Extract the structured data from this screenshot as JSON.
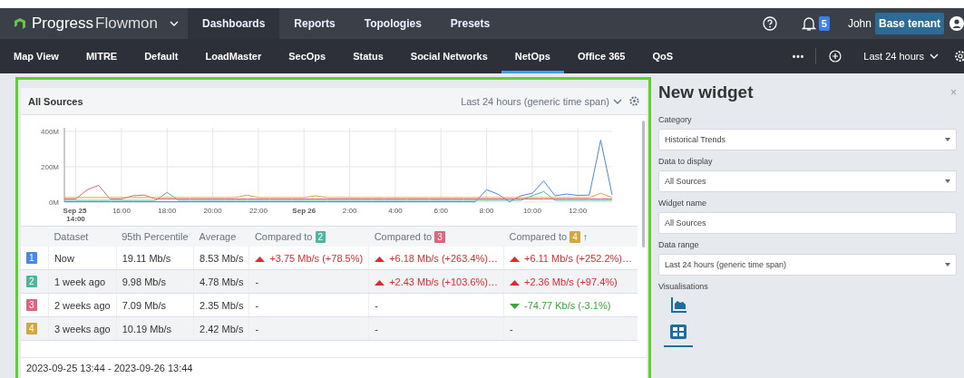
{
  "topbar": {
    "logo": {
      "brand": "Progress",
      "product": "Flowmon"
    },
    "menu": [
      {
        "label": "Dashboards",
        "selected": true
      },
      {
        "label": "Reports",
        "selected": false
      },
      {
        "label": "Topologies",
        "selected": false
      },
      {
        "label": "Presets",
        "selected": false
      }
    ],
    "notifications": "5",
    "user": "John",
    "tenant": "Base tenant"
  },
  "dashboard_tabs": [
    {
      "label": "Map View",
      "selected": false
    },
    {
      "label": "MITRE",
      "selected": false
    },
    {
      "label": "Default",
      "selected": false
    },
    {
      "label": "LoadMaster",
      "selected": false
    },
    {
      "label": "SecOps",
      "selected": false
    },
    {
      "label": "Status",
      "selected": false
    },
    {
      "label": "Social Networks",
      "selected": false
    },
    {
      "label": "NetOps",
      "selected": true
    },
    {
      "label": "Office 365",
      "selected": false
    },
    {
      "label": "QoS",
      "selected": false
    }
  ],
  "more": "•••",
  "time_range": "Last 24 hours",
  "widget": {
    "title": "All Sources",
    "time_span": "Last 24 hours (generic time span)",
    "chart_data": {
      "type": "line",
      "categories": [
        null,
        "Sep 25 14:00",
        null,
        null,
        null,
        "16:00",
        null,
        null,
        null,
        "18:00",
        null,
        null,
        null,
        "20:00",
        null,
        null,
        null,
        "22:00",
        null,
        null,
        null,
        "Sep 26",
        null,
        null,
        null,
        "2:00",
        null,
        null,
        null,
        "4:00",
        null,
        null,
        null,
        "6:00",
        null,
        null,
        null,
        "8:00",
        null,
        null,
        null,
        "10:00",
        null,
        null,
        null,
        "12:00",
        null,
        null,
        null
      ],
      "yticks": [
        {
          "value": 0,
          "label": "0M"
        },
        {
          "value": 200,
          "label": "200M"
        },
        {
          "value": 400,
          "label": "400M"
        }
      ],
      "ylim": [
        0,
        420
      ],
      "grid": true,
      "series": [
        {
          "color": "#4a86e8",
          "values": [
            2,
            2,
            2,
            2,
            2,
            2,
            2,
            2,
            2,
            2,
            2,
            2,
            2,
            2,
            2,
            2,
            2,
            2,
            2,
            2,
            2,
            2,
            2,
            2,
            2,
            2,
            2,
            2,
            2,
            2,
            2,
            2,
            2,
            2,
            2,
            2,
            2,
            70,
            45,
            2,
            36,
            50,
            120,
            36,
            46,
            38,
            40,
            350,
            40
          ]
        },
        {
          "color": "#4db6a0",
          "values": [
            10,
            10,
            10,
            10,
            10,
            10,
            10,
            10,
            10,
            55,
            10,
            10,
            10,
            10,
            10,
            10,
            10,
            10,
            10,
            10,
            10,
            10,
            10,
            10,
            10,
            10,
            10,
            10,
            10,
            10,
            10,
            10,
            10,
            10,
            10,
            10,
            10,
            10,
            10,
            10,
            10,
            36,
            60,
            10,
            10,
            10,
            10,
            10,
            10
          ]
        },
        {
          "color": "#e0637f",
          "values": [
            18,
            18,
            70,
            95,
            18,
            18,
            36,
            40,
            18,
            18,
            18,
            18,
            18,
            18,
            18,
            18,
            18,
            18,
            18,
            18,
            18,
            18,
            18,
            18,
            18,
            18,
            18,
            18,
            18,
            18,
            18,
            18,
            18,
            18,
            18,
            18,
            18,
            18,
            18,
            18,
            18,
            18,
            18,
            18,
            18,
            18,
            18,
            18,
            18
          ]
        },
        {
          "color": "#d4a640",
          "values": [
            26,
            26,
            26,
            26,
            26,
            26,
            26,
            26,
            26,
            26,
            26,
            26,
            26,
            26,
            26,
            26,
            40,
            26,
            26,
            26,
            26,
            26,
            36,
            26,
            26,
            26,
            26,
            26,
            26,
            26,
            26,
            26,
            26,
            26,
            26,
            26,
            26,
            26,
            26,
            26,
            26,
            26,
            26,
            26,
            26,
            26,
            26,
            50,
            26
          ]
        }
      ]
    },
    "columns": [
      {
        "label": "Dataset"
      },
      {
        "label": "95th Percentile"
      },
      {
        "label": "Average"
      },
      {
        "label": "Compared to",
        "badge": "2",
        "color": "#4db6a0"
      },
      {
        "label": "Compared to",
        "badge": "3",
        "color": "#e0637f"
      },
      {
        "label": "Compared to",
        "badge": "4",
        "color": "#d4a640",
        "sort": "↑"
      }
    ],
    "rows": [
      {
        "badge": "1",
        "color": "#4a86e8",
        "dataset": "Now",
        "p95": "19.11 Mb/s",
        "average": "8.53 Mb/s",
        "compare": [
          {
            "text": "+3.75 Mb/s (+78.5%)",
            "kind": "increase"
          },
          {
            "text": "+6.18 Mb/s (+263.4%)…",
            "kind": "increase"
          },
          {
            "text": "+6.11 Mb/s (+252.2%)…",
            "kind": "increase"
          }
        ]
      },
      {
        "badge": "2",
        "color": "#4db6a0",
        "dataset": "1 week ago",
        "p95": "9.98 Mb/s",
        "average": "4.78 Mb/s",
        "compare": [
          {
            "text": "-",
            "kind": "none"
          },
          {
            "text": "+2.43 Mb/s (+103.6%)…",
            "kind": "increase"
          },
          {
            "text": "+2.36 Mb/s (+97.4%)",
            "kind": "increase"
          }
        ]
      },
      {
        "badge": "3",
        "color": "#e0637f",
        "dataset": "2 weeks ago",
        "p95": "7.09 Mb/s",
        "average": "2.35 Mb/s",
        "compare": [
          {
            "text": "-",
            "kind": "none"
          },
          {
            "text": "-",
            "kind": "none"
          },
          {
            "text": "-74.77 Kb/s (-3.1%)",
            "kind": "decrease"
          }
        ]
      },
      {
        "badge": "4",
        "color": "#d4a640",
        "dataset": "3 weeks ago",
        "p95": "10.19 Mb/s",
        "average": "2.42 Mb/s",
        "compare": [
          {
            "text": "-",
            "kind": "none"
          },
          {
            "text": "-",
            "kind": "none"
          },
          {
            "text": "-",
            "kind": "none"
          }
        ]
      }
    ],
    "footer": "2023-09-25 13:44 - 2023-09-26 13:44"
  },
  "panel": {
    "title": "New widget",
    "close": "×",
    "fields": [
      {
        "label": "Category",
        "value": "Historical Trends",
        "kind": "select"
      },
      {
        "label": "Data to display",
        "value": "All Sources",
        "kind": "select"
      },
      {
        "label": "Widget name",
        "value": "All Sources",
        "kind": "text"
      },
      {
        "label": "Data range",
        "value": "Last 24 hours (generic time span)",
        "kind": "select"
      }
    ],
    "visualisations_label": "Visualisations",
    "visualisations": [
      {
        "kind": "chart",
        "selected": false
      },
      {
        "kind": "table",
        "selected": true
      }
    ]
  }
}
